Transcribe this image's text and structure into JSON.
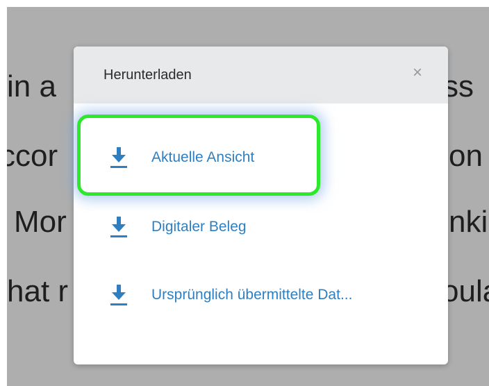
{
  "background_text": {
    "lines": [
      {
        "left": "in  a",
        "right": "ss"
      },
      {
        "left": "ccor",
        "right": "on"
      },
      {
        "left": "Mor",
        "right": "nki"
      },
      {
        "left": "hat r",
        "right": "oula"
      }
    ]
  },
  "dialog": {
    "title": "Herunterladen",
    "close_glyph": "×",
    "items": [
      {
        "label": "Aktuelle Ansicht",
        "icon": "download-icon"
      },
      {
        "label": "Digitaler Beleg",
        "icon": "download-icon"
      },
      {
        "label": "Ursprünglich übermittelte Dat...",
        "icon": "download-icon"
      }
    ]
  },
  "colors": {
    "accent": "#2f7fc0",
    "highlight": "#2ee82e",
    "overlay": "#aeaeae",
    "header": "#e8e9eb"
  }
}
